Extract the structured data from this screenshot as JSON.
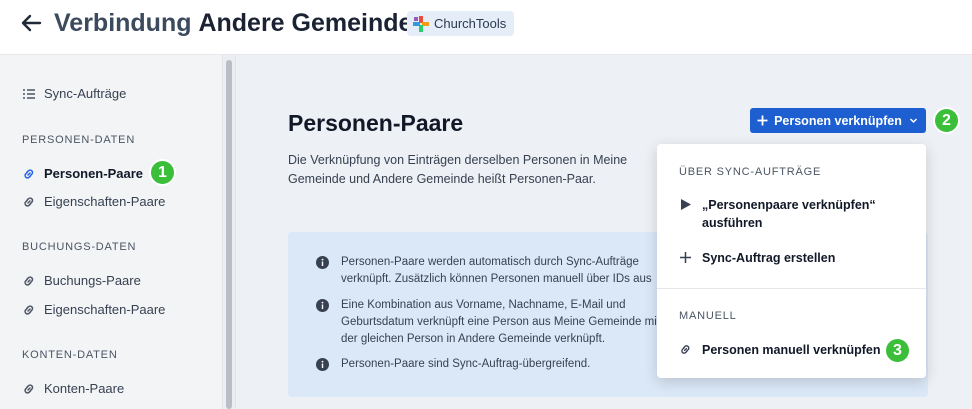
{
  "header": {
    "title_part1": "Verbindung",
    "title_part2": "Andere Gemeinde",
    "badge_label": "ChurchTools"
  },
  "sidebar": {
    "sync_jobs_label": "Sync-Aufträge",
    "sections": [
      {
        "title": "PERSONEN-DATEN",
        "items": [
          "Personen-Paare",
          "Eigenschaften-Paare"
        ]
      },
      {
        "title": "BUCHUNGS-DATEN",
        "items": [
          "Buchungs-Paare",
          "Eigenschaften-Paare"
        ]
      },
      {
        "title": "KONTEN-DATEN",
        "items": [
          "Konten-Paare"
        ]
      }
    ],
    "active_item": "Personen-Paare"
  },
  "main": {
    "heading": "Personen-Paare",
    "description": "Die Verknüpfung von Einträgen derselben Personen in Meine Gemeinde und Andere Gemeinde heißt Personen-Paar.",
    "link_button_label": "Personen verknüpfen",
    "info": [
      "Personen-Paare werden automatisch durch Sync-Aufträge verknüpft. Zusätzlich können Personen manuell über IDs aus dem eigenen und externen System verknüpft werden.",
      "Eine Kombination aus Vorname, Nachname, E-Mail und Geburtsdatum verknüpft eine Person aus Meine Gemeinde mit der gleichen Person in Andere Gemeinde verknüpft. Voraussetzung ist, dass Vor- und Nachname einer Person in beiden Systemen übereinstimmen.",
      "Personen-Paare sind Sync-Auftrag-übergreifend."
    ]
  },
  "dropdown": {
    "section1": "ÜBER SYNC-AUFTRÄGE",
    "run_item_line1": "„Personenpaare verknüpfen“",
    "run_item_line2": "ausführen",
    "create_item": "Sync-Auftrag erstellen",
    "section2": "MANUELL",
    "manual_item": "Personen manuell verknüpfen"
  },
  "callouts": [
    "1",
    "2",
    "3"
  ],
  "colors": {
    "primary": "#1d5fd1",
    "callout_green": "#3bbf3b",
    "info_bg": "#dbe8f7",
    "link_icon": "#2563eb"
  }
}
